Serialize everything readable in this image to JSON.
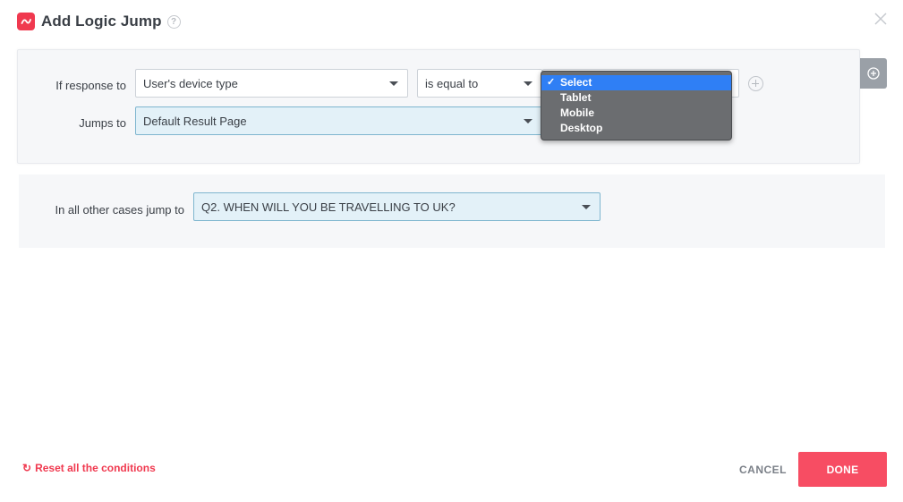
{
  "header": {
    "title": "Add Logic Jump",
    "help_icon": "?"
  },
  "rule": {
    "if_label": "If response to",
    "device_select": "User's device type",
    "operator_select": "is equal to",
    "value_options": [
      {
        "label": "Select",
        "selected": true
      },
      {
        "label": "Tablet",
        "selected": false
      },
      {
        "label": "Mobile",
        "selected": false
      },
      {
        "label": "Desktop",
        "selected": false
      }
    ],
    "jumps_label": "Jumps to",
    "jump_select": "Default Result Page"
  },
  "other": {
    "label": "In all other cases jump to",
    "select": "Q2. WHEN WILL YOU BE TRAVELLING TO UK?"
  },
  "footer": {
    "reset_label": "Reset all the conditions",
    "cancel_label": "CANCEL",
    "done_label": "DONE"
  },
  "colors": {
    "accent": "#f0394f",
    "done_bg": "#f74d63",
    "dropdown_highlight": "#2f7ff5"
  }
}
